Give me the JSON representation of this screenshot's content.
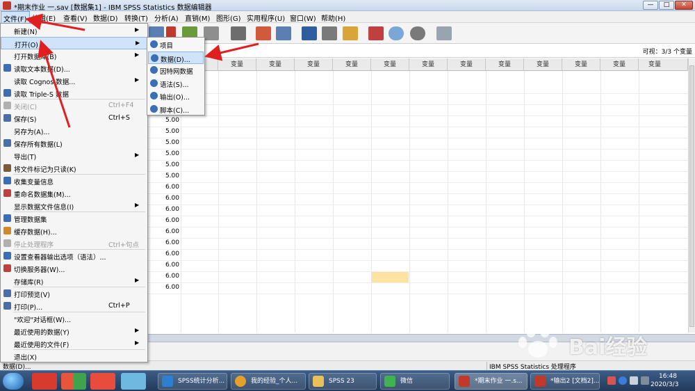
{
  "window": {
    "title": "*期末作业 一.sav [数据集1] - IBM SPSS Statistics 数据编辑器",
    "min": "—",
    "max": "□",
    "close": "✕"
  },
  "menubar": [
    "文件(F)",
    "编辑(E)",
    "查看(V)",
    "数据(D)",
    "转换(T)",
    "分析(A)",
    "直销(M)",
    "图形(G)",
    "实用程序(U)",
    "窗口(W)",
    "帮助(H)"
  ],
  "varbar": {
    "visible": "可视：3/3 个变量"
  },
  "grid": {
    "column_header": "变量",
    "values": [
      "5.00",
      "5.00",
      "5.00",
      "5.00",
      "5.00",
      "5.00",
      "6.00",
      "6.00",
      "6.00",
      "6.00",
      "6.00",
      "6.00",
      "6.00",
      "6.00",
      "6.00",
      "6.00"
    ]
  },
  "file_menu": [
    {
      "label": "新建(N)",
      "arrow": "▶"
    },
    {
      "label": "打开(O)",
      "arrow": "▶",
      "highlight": true
    },
    {
      "label": "打开数据库(B)",
      "arrow": "▶"
    },
    {
      "label": "读取文本数据(D)...",
      "icon": "#3a6fb5"
    },
    {
      "label": "读取 Cognos 数据...",
      "arrow": "▶"
    },
    {
      "label": "读取 Triple-S 数据",
      "icon": "#3a6fb5"
    },
    {
      "label": "关闭(C)",
      "shortcut": "Ctrl+F4",
      "disabled": true,
      "icon": "#b0b0b0"
    },
    {
      "label": "保存(S)",
      "shortcut": "Ctrl+S",
      "icon": "#4a6ea8"
    },
    {
      "label": "另存为(A)..."
    },
    {
      "label": "保存所有数据(L)",
      "icon": "#4a6ea8"
    },
    {
      "label": "导出(T)",
      "arrow": "▶"
    },
    {
      "label": "将文件标记为只读(K)",
      "icon": "#7a5c3a"
    },
    {
      "label": "收集变量信息",
      "icon": "#3a6fb5"
    },
    {
      "label": "重命名数据集(M)...",
      "icon": "#c04040"
    },
    {
      "label": "显示数据文件信息(I)",
      "arrow": "▶"
    },
    {
      "label": "管理数据集",
      "icon": "#3a6fb5"
    },
    {
      "label": "缓存数据(H)...",
      "icon": "#d08a2a"
    },
    {
      "label": "停止处理程序",
      "shortcut": "Ctrl+句点",
      "disabled": true,
      "icon": "#b0b0b0"
    },
    {
      "label": "设置查看器输出选项（语法）...",
      "icon": "#3a6fb5"
    },
    {
      "label": "切换服务器(W)...",
      "icon": "#c04040"
    },
    {
      "label": "存储库(R)",
      "arrow": "▶"
    },
    {
      "label": "打印预览(V)",
      "icon": "#4a6ea8"
    },
    {
      "label": "打印(P)...",
      "shortcut": "Ctrl+P",
      "icon": "#4a6ea8"
    },
    {
      "label": "\"欢迎\"对话框(W)..."
    },
    {
      "label": "最近使用的数据(Y)",
      "arrow": "▶"
    },
    {
      "label": "最近使用的文件(F)",
      "arrow": "▶"
    },
    {
      "label": "退出(X)"
    }
  ],
  "open_submenu": [
    {
      "label": "项目",
      "icon": "#3a6fb5"
    },
    {
      "label": "数据(D)...",
      "icon": "#3a6fb5",
      "highlight": true
    },
    {
      "label": "因特网数据",
      "icon": "#3a6fb5"
    },
    {
      "label": "语法(S)...",
      "icon": "#3a6fb5"
    },
    {
      "label": "输出(O)...",
      "icon": "#3a6fb5"
    },
    {
      "label": "脚本(C)...",
      "icon": "#3a6fb5"
    }
  ],
  "statusbar": {
    "left": "数据(D)...",
    "right": "IBM SPSS Statistics 处理程序"
  },
  "taskbar": {
    "tasks": [
      "SPSS统计分析...",
      "我的经验_个人...",
      "SPSS 23",
      "微信",
      "*期末作业 一.s...",
      "*输出2 [文档2]..."
    ],
    "time": "16:48",
    "date": "2020/3/3"
  },
  "watermark": "Bai经验",
  "colors": {
    "menu_highlight": "#cfe3fb",
    "arrow_red": "#e02020",
    "selected_cell": "#fde3a1"
  }
}
